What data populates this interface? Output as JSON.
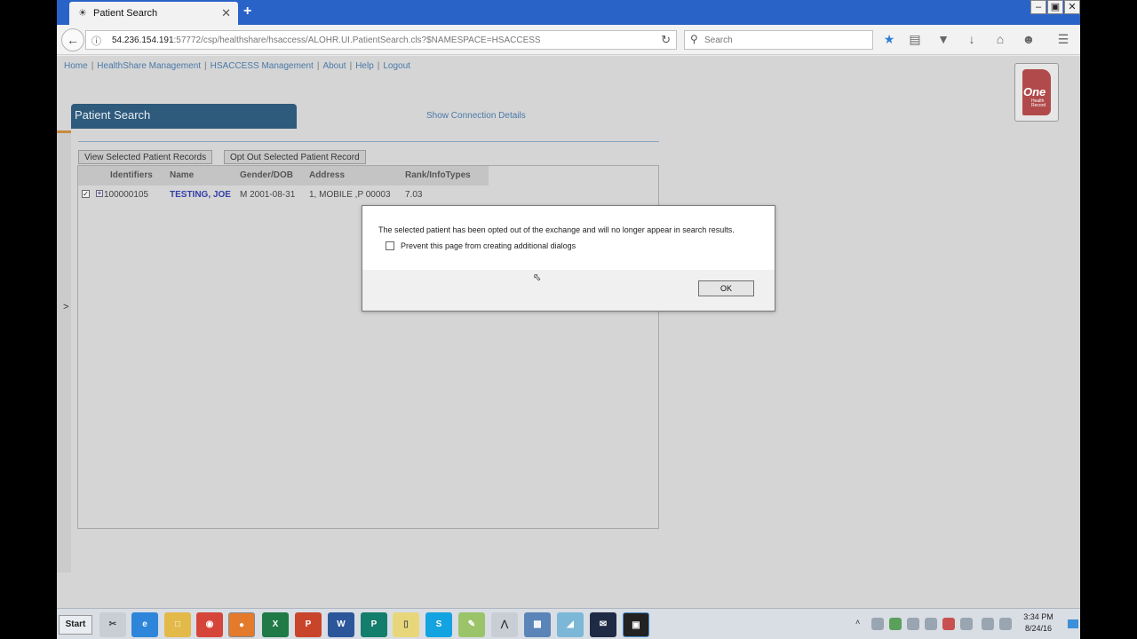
{
  "browser": {
    "tab_title": "Patient Search",
    "url_host": "54.236.154.191",
    "url_path": ":57772/csp/healthshare/hsaccess/ALOHR.UI.PatientSearch.cls?$NAMESPACE=HSACCESS",
    "search_placeholder": "Search",
    "window_controls": [
      "–",
      "▣",
      "✕"
    ]
  },
  "topnav": {
    "links": [
      "Home",
      "HealthShare Management",
      "HSACCESS Management",
      "About",
      "Help",
      "Logout"
    ]
  },
  "logo": {
    "word": "One",
    "tagline": "Health Record"
  },
  "page": {
    "title": "Patient Search",
    "connection_link": "Show Connection Details",
    "collapse_arrow": ">"
  },
  "toolbar": {
    "view_label": "View Selected Patient Records",
    "optout_label": "Opt Out Selected Patient Record"
  },
  "grid": {
    "columns": [
      "Identifiers",
      "Name",
      "Gender/DOB",
      "Address",
      "Rank/InfoTypes"
    ],
    "rows": [
      {
        "identifier": "100000105",
        "name": "TESTING, JOE",
        "gender_dob": "M 2001-08-31",
        "address": "1, MOBILE ,P 00003",
        "rank": "7.03"
      }
    ]
  },
  "dialog": {
    "message": "The selected patient has been opted out of the exchange and will no longer appear in search results.",
    "checkbox_label": "Prevent this page from creating additional dialogs",
    "ok_label": "OK"
  },
  "taskbar": {
    "start_label": "Start",
    "clock_time": "3:34 PM",
    "clock_date": "8/24/16"
  }
}
